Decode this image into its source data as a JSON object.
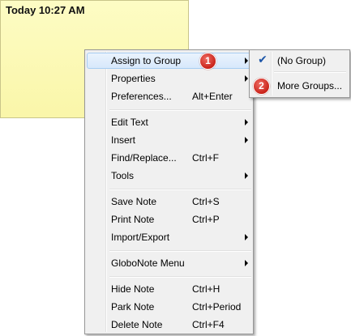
{
  "note": {
    "title": "Today 10:27 AM"
  },
  "menu": {
    "items": [
      {
        "label": "Assign to Group",
        "accel": "",
        "submenu": true
      },
      {
        "label": "Properties",
        "accel": "",
        "submenu": true
      },
      {
        "label": "Preferences...",
        "accel": "Alt+Enter",
        "submenu": false
      },
      {
        "label": "Edit Text",
        "accel": "",
        "submenu": true
      },
      {
        "label": "Insert",
        "accel": "",
        "submenu": true
      },
      {
        "label": "Find/Replace...",
        "accel": "Ctrl+F",
        "submenu": false
      },
      {
        "label": "Tools",
        "accel": "",
        "submenu": true
      },
      {
        "label": "Save Note",
        "accel": "Ctrl+S",
        "submenu": false
      },
      {
        "label": "Print Note",
        "accel": "Ctrl+P",
        "submenu": false
      },
      {
        "label": "Import/Export",
        "accel": "",
        "submenu": true
      },
      {
        "label": "GloboNote Menu",
        "accel": "",
        "submenu": true
      },
      {
        "label": "Hide Note",
        "accel": "Ctrl+H",
        "submenu": false
      },
      {
        "label": "Park Note",
        "accel": "Ctrl+Period",
        "submenu": false
      },
      {
        "label": "Delete Note",
        "accel": "Ctrl+F4",
        "submenu": false
      }
    ]
  },
  "submenu": {
    "items": [
      {
        "label": "(No Group)",
        "checked": true
      },
      {
        "label": "More Groups...",
        "checked": false
      }
    ]
  },
  "badges": {
    "first": "1",
    "second": "2"
  },
  "colors": {
    "note_bg": "#faf6a9",
    "badge": "#d9342b",
    "check": "#1d56a8"
  }
}
